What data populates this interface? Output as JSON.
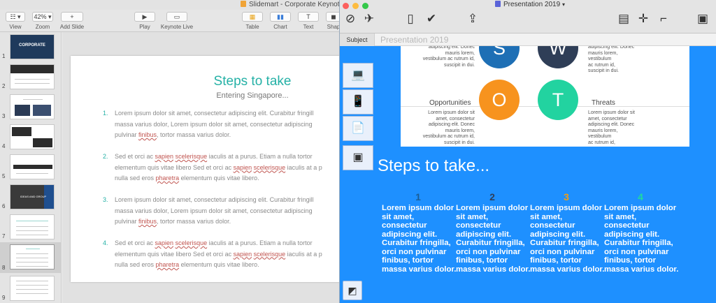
{
  "keynote": {
    "window_title": "Slidemart - Corporate Keynote",
    "toolbar": {
      "view_label": "View",
      "zoom_value": "42%",
      "zoom_label": "Zoom",
      "add_slide_label": "Add Slide",
      "play_label": "Play",
      "keynote_live_label": "Keynote Live",
      "table_label": "Table",
      "chart_label": "Chart",
      "text_label": "Text",
      "shape_label": "Shap"
    },
    "slide_numbers": [
      "1",
      "2",
      "3",
      "4",
      "5",
      "6",
      "7",
      "8",
      "9"
    ],
    "thumb1_title": "CORPORATE",
    "thumb6_title": "IDEAS AND GROUP",
    "slide": {
      "title": "Steps to take",
      "subtitle": "Entering Singapore...",
      "items": [
        {
          "num": "1.",
          "lines": [
            "Lorem ipsum dolor sit amet, consectetur adipiscing elit. Curabitur fringill",
            "massa varius dolor, Lorem ipsum dolor sit amet, consectetur adipiscing",
            "pulvinar finibus, tortor massa varius dolor."
          ]
        },
        {
          "num": "2.",
          "lines": [
            "Sed et orci ac sapien scelerisque iaculis at a purus. Etiam a nulla tortor",
            "elementum quis vitae libero Sed et orci ac sapien scelerisque iaculis at a p",
            "nulla sed eros pharetra elementum quis vitae libero."
          ]
        },
        {
          "num": "3.",
          "lines": [
            "Lorem ipsum dolor sit amet, consectetur adipiscing elit. Curabitur fringill",
            "massa varius dolor, Lorem ipsum dolor sit amet, consectetur adipiscing",
            "pulvinar finibus, tortor massa varius dolor."
          ]
        },
        {
          "num": "4.",
          "lines": [
            "Sed et orci ac sapien scelerisque iaculis at a purus. Etiam a nulla tortor",
            "elementum quis vitae libero Sed et orci ac sapien scelerisque iaculis at a p",
            "nulla sed eros pharetra elementum quis vitae libero."
          ]
        }
      ]
    }
  },
  "presentation": {
    "window_title": "Presentation 2019",
    "subject_label": "Subject",
    "subject_value": "Presentation 2019",
    "swot": {
      "s_letter": "S",
      "w_letter": "W",
      "o_letter": "O",
      "t_letter": "T",
      "s_text": "adipiscing elit. Donec\nmauris lorem,\nvestibulum ac rutrum id,\nsuscipit in dui.",
      "w_text": "adipiscing elit. Donec\nmauris lorem,\nvestibulum\nac rutrum id,\nsuscipit in dui.",
      "opportunities_heading": "Opportunities",
      "threats_heading": "Threats",
      "o_text": "Lorem ipsum dolor sit\namet, consectetur\nadipiscing elit. Donec\nmauris lorem,\nvestibulum ac rutrum id,\nsuscipit in dui.",
      "t_text": "Lorem ipsum dolor sit\namet, consectetur\nadipiscing elit. Donec\nmauris lorem,\nvestibulum\nac rutrum id,\nsuscipit in dui."
    },
    "steps_title": "Steps to take...",
    "steps": [
      {
        "num": "1",
        "color": "#1b5e96",
        "text": "Lorem ipsum dolor\nsit amet,\nconsectetur\nadipiscing elit.\nCurabitur fringilla,\norci non pulvinar\nfinibus, tortor\nmassa varius dolor."
      },
      {
        "num": "2",
        "color": "#2e3f5c",
        "text": "Lorem ipsum dolor\nsit amet,\nconsectetur\nadipiscing elit.\nCurabitur fringilla,\norci non pulvinar\nfinibus, tortor\nmassa varius dolor."
      },
      {
        "num": "3",
        "color": "#f39c12",
        "text": "Lorem ipsum dolor\nsit amet,\nconsectetur\nadipiscing elit.\nCurabitur fringilla,\norci non pulvinar\nfinibus, tortor\nmassa varius dolor."
      },
      {
        "num": "4",
        "color": "#1ddba0",
        "text": "Lorem ipsum dolor\nsit amet,\nconsectetur\nadipiscing elit.\nCurabitur fringilla,\norci non pulvinar\nfinibus, tortor\nmassa varius dolor."
      }
    ]
  },
  "colors": {
    "accent_teal": "#25b1a6",
    "presentation_blue": "#1e90ff",
    "swot_s": "#1e6fb5",
    "swot_w": "#2f3e57",
    "swot_o": "#f7931e",
    "swot_t": "#22d3a0"
  }
}
